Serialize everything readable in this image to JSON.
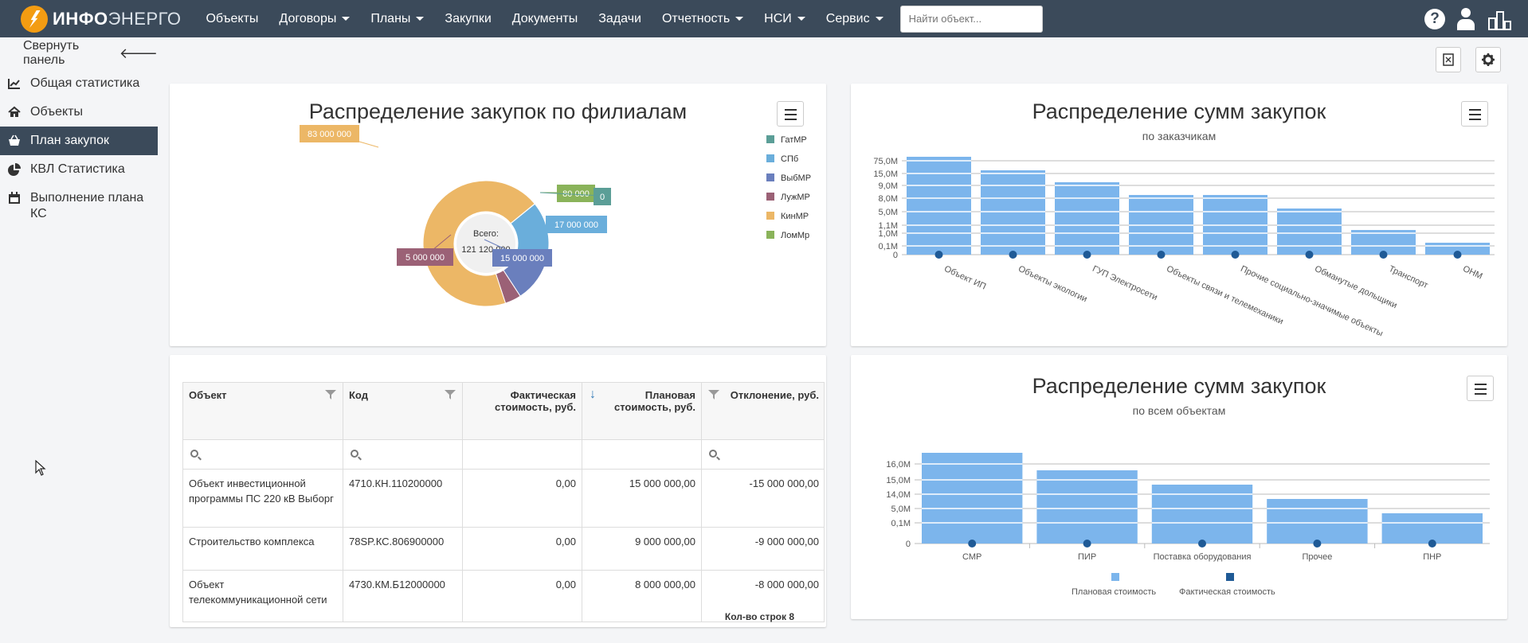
{
  "app": {
    "logo_bold": "ИНФО",
    "logo_light": "ЭНЕРГО"
  },
  "nav": {
    "items": [
      {
        "label": "Объекты",
        "dropdown": false
      },
      {
        "label": "Договоры",
        "dropdown": true
      },
      {
        "label": "Планы",
        "dropdown": true
      },
      {
        "label": "Закупки",
        "dropdown": false
      },
      {
        "label": "Документы",
        "dropdown": false
      },
      {
        "label": "Задачи",
        "dropdown": false
      },
      {
        "label": "Отчетность",
        "dropdown": true
      },
      {
        "label": "НСИ",
        "dropdown": true
      },
      {
        "label": "Сервис",
        "dropdown": true
      }
    ],
    "search_placeholder": "Найти объект...",
    "help_glyph": "?"
  },
  "sidebar": {
    "collapse_label": "Свернуть панель",
    "collapse_arrow": "🡐",
    "items": [
      {
        "label": "Общая статистика",
        "icon": "line-chart-icon",
        "active": false
      },
      {
        "label": "Объекты",
        "icon": "home-icon",
        "active": false
      },
      {
        "label": "План закупок",
        "icon": "basket-icon",
        "active": true
      },
      {
        "label": "КВЛ Статистика",
        "icon": "pie-chart-icon",
        "active": false
      },
      {
        "label": "Выполнение плана КС",
        "icon": "calendar-icon",
        "active": false
      }
    ]
  },
  "colors": {
    "navbar": "#3b4a5a",
    "bar_plan": "#7cb5ec",
    "bar_fact": "#1f5a96",
    "accent": "#f39c12"
  },
  "donut": {
    "title": "Распределение закупок по филиалам",
    "center_label": "Всего:",
    "center_value": "121 120 000",
    "legend": [
      {
        "name": "ГатМР",
        "color": "#5b9e97"
      },
      {
        "name": "СПб",
        "color": "#6aaedb"
      },
      {
        "name": "ВыбМР",
        "color": "#6a7fbd"
      },
      {
        "name": "ЛужМР",
        "color": "#9b6176"
      },
      {
        "name": "КинМР",
        "color": "#ecb766"
      },
      {
        "name": "ЛомМр",
        "color": "#8ab35a"
      }
    ],
    "labels": [
      "83 000 000",
      "80 000",
      "0",
      "17 000 000",
      "15 000 000",
      "5 000 000"
    ]
  },
  "bar_top": {
    "title": "Распределение сумм закупок",
    "subtitle": "по заказчикам"
  },
  "bar_bottom": {
    "title": "Распределение сумм закупок",
    "subtitle": "по всем объектам",
    "legend_plan": "Плановая стоимость",
    "legend_fact": "Фактическая стоимость"
  },
  "chart_data": [
    {
      "type": "pie",
      "title": "Распределение закупок по филиалам",
      "categories": [
        "ГатМР",
        "СПб",
        "ВыбМР",
        "ЛужМР",
        "КинМР",
        "ЛомМр"
      ],
      "values": [
        0,
        17000000,
        15000000,
        5000000,
        83000000,
        80000
      ],
      "legend": "right"
    },
    {
      "type": "bar",
      "title": "Распределение сумм закупок",
      "subtitle": "по заказчикам",
      "categories": [
        "Объект ИП",
        "Объекты экологии",
        "ГУП Электросети",
        "Объекты связи и телемеханики",
        "Прочие социально-значимые объекты",
        "Обманутые дольщики",
        "Транспорт",
        "ОНМ"
      ],
      "y_ticks": [
        "0",
        "0,1M",
        "1,0M",
        "1,1M",
        "5,0M",
        "8,0M",
        "9,0M",
        "15,0M",
        "75,0M"
      ],
      "series": [
        {
          "name": "Плановая стоимость",
          "values": [
            75.0,
            15.0,
            9.0,
            8.0,
            8.0,
            5.0,
            1.0,
            0.1
          ]
        },
        {
          "name": "Фактическая стоимость",
          "values": [
            0,
            0,
            0,
            0,
            0,
            0,
            0,
            0
          ]
        }
      ],
      "grid": true
    },
    {
      "type": "bar",
      "title": "Распределение сумм закупок",
      "subtitle": "по всем объектам",
      "categories": [
        "СМР",
        "ПИР",
        "Поставка оборудования",
        "Прочее",
        "ПНР"
      ],
      "y_ticks": [
        "0",
        "0,1M",
        "5,0M",
        "14,0M",
        "15,0M",
        "16,0M"
      ],
      "series": [
        {
          "name": "Плановая стоимость",
          "values": [
            16.0,
            15.0,
            14.0,
            5.0,
            0.1
          ]
        },
        {
          "name": "Фактическая стоимость",
          "values": [
            0,
            0,
            0,
            0,
            0
          ]
        }
      ],
      "legend": "bottom",
      "grid": true
    }
  ],
  "table": {
    "columns": [
      "Объект",
      "Код",
      "Фактическая стоимость, руб.",
      "Плановая стоимость, руб.",
      "Отклонение, руб."
    ],
    "rows": [
      [
        "Объект инвестиционной программы ПС 220 кВ Выборг",
        "4710.КН.110200000",
        "0,00",
        "15 000 000,00",
        "-15 000 000,00"
      ],
      [
        "Строительство комплекса",
        "78SP.КС.806900000",
        "0,00",
        "9 000 000,00",
        "-9 000 000,00"
      ],
      [
        "Объект телекоммуникационной сети",
        "4730.КМ.Б12000000",
        "0,00",
        "8 000 000,00",
        "-8 000 000,00"
      ]
    ],
    "row_count_label": "Кол-во строк 8",
    "sort_glyph": "↓",
    "help_glyph": "?"
  }
}
